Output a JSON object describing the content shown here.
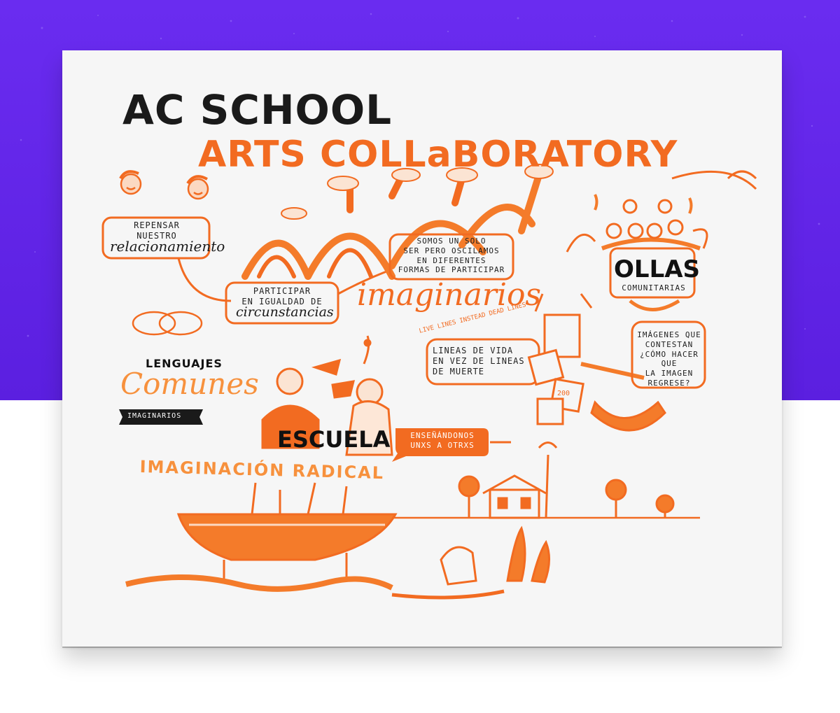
{
  "title": {
    "line1": "AC SCHOOL",
    "line2": "ARTS COLLaBORATORY"
  },
  "notes": {
    "repensar_top": "REPENSAR\nNUESTRO",
    "repensar_script": "relacionamiento",
    "participar_top": "PARTICIPAR\nEN IGUALDAD DE",
    "participar_script": "circunstancias",
    "somos": "SOMOS UN SOLO\nSER PERO OSCILAMOS\nEN DIFERENTES\nFORMAS DE PARTICIPAR",
    "imaginarios_script": "imaginarios",
    "ollas_title": "OLLAS",
    "ollas_sub": "COMUNITARIAS",
    "live_lines": "LIVE LINES INSTEAD DEAD LINES",
    "lineas": "LINEAS DE VIDA\nEN VEZ DE LINEAS\nDE MUERTE",
    "imagenes": "IMÁGENES QUE\nCONTESTAN\n¿CÓMO HACER QUE\nLA IMAGEN\nREGRESE?",
    "lenguajes": "LENGUAJES",
    "comunes_script": "Comunes",
    "imaginarios_banner": "IMAGINARIOS",
    "escuela": "ESCUELA",
    "ensenandonos": "ENSEÑÁNDONOS\nUNXS A OTRXS",
    "imaginacion": "IMAGINACIÓN RADICAL",
    "paper_number": "200"
  },
  "colors": {
    "accent": "#f26b21",
    "accent_light": "#f7913d",
    "ink": "#1a1a1a",
    "purple": "#5b1fe0"
  }
}
